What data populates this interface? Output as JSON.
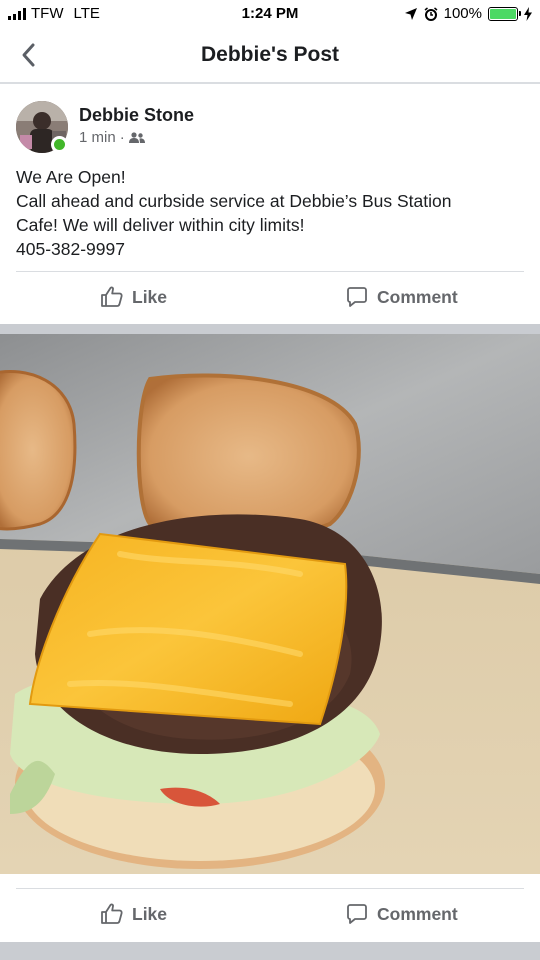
{
  "status_bar": {
    "carrier": "TFW",
    "network": "LTE",
    "time": "1:24 PM",
    "battery": "100%",
    "battery_fill": 1.0,
    "battery_color": "#4cd964"
  },
  "nav": {
    "back_icon": "chevron-left-icon",
    "title": "Debbie's Post"
  },
  "post": {
    "author": "Debbie Stone",
    "time": "1 min",
    "separator": "·",
    "audience_icon": "friends-icon",
    "online": true,
    "online_color": "#42b72a",
    "text_lines": [
      "We Are Open!",
      "Call ahead and curbside service at Debbie’s Bus Station",
      "Cafe! We will deliver within city limits!",
      "405-382-9997"
    ]
  },
  "actions": [
    {
      "like_label": "Like",
      "comment_label": "Comment"
    },
    {
      "like_label": "Like",
      "comment_label": "Comment"
    }
  ]
}
